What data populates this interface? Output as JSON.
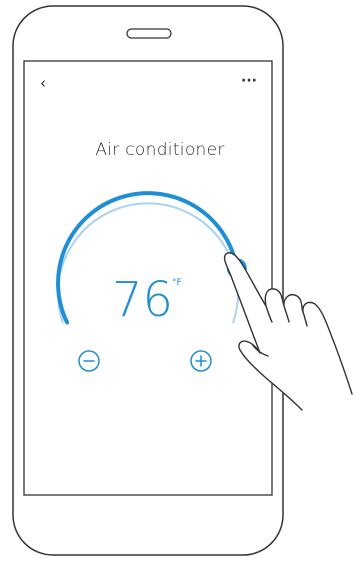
{
  "header": {
    "back_glyph": "‹",
    "more_glyph": "···"
  },
  "device": {
    "title": "Air conditioner"
  },
  "thermostat": {
    "temperature": "76",
    "unit": "°F",
    "dial_level": 0.78
  },
  "controls": {
    "minus_icon": "minus-circle-icon",
    "plus_icon": "plus-circle-icon"
  },
  "colors": {
    "accent": "#1e8fd4",
    "accent_light": "#a9d4f0",
    "outline": "#333333"
  }
}
